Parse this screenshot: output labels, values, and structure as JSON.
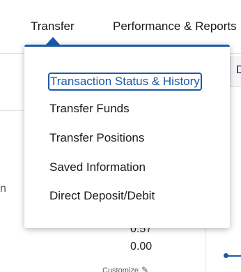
{
  "topnav": {
    "tabs": [
      {
        "label": "Transfer",
        "active": true
      },
      {
        "label": "Performance & Reports",
        "active": false
      }
    ]
  },
  "dropdown": {
    "items": [
      {
        "label": "Transaction Status & History",
        "focused": true
      },
      {
        "label": "Transfer Funds"
      },
      {
        "label": "Transfer Positions"
      },
      {
        "label": "Saved Information"
      },
      {
        "label": "Direct Deposit/Debit"
      }
    ]
  },
  "background": {
    "left_fragment": "n",
    "right_tab_letter": "D",
    "values": [
      "0.57",
      "0.00"
    ],
    "customize_label": "Customize"
  },
  "colors": {
    "accent": "#1b5aa8",
    "text": "#1a1a1a",
    "divider": "#dcdcdc"
  },
  "icons": {
    "pencil": "pencil-icon",
    "caret": "caret-up-icon"
  }
}
